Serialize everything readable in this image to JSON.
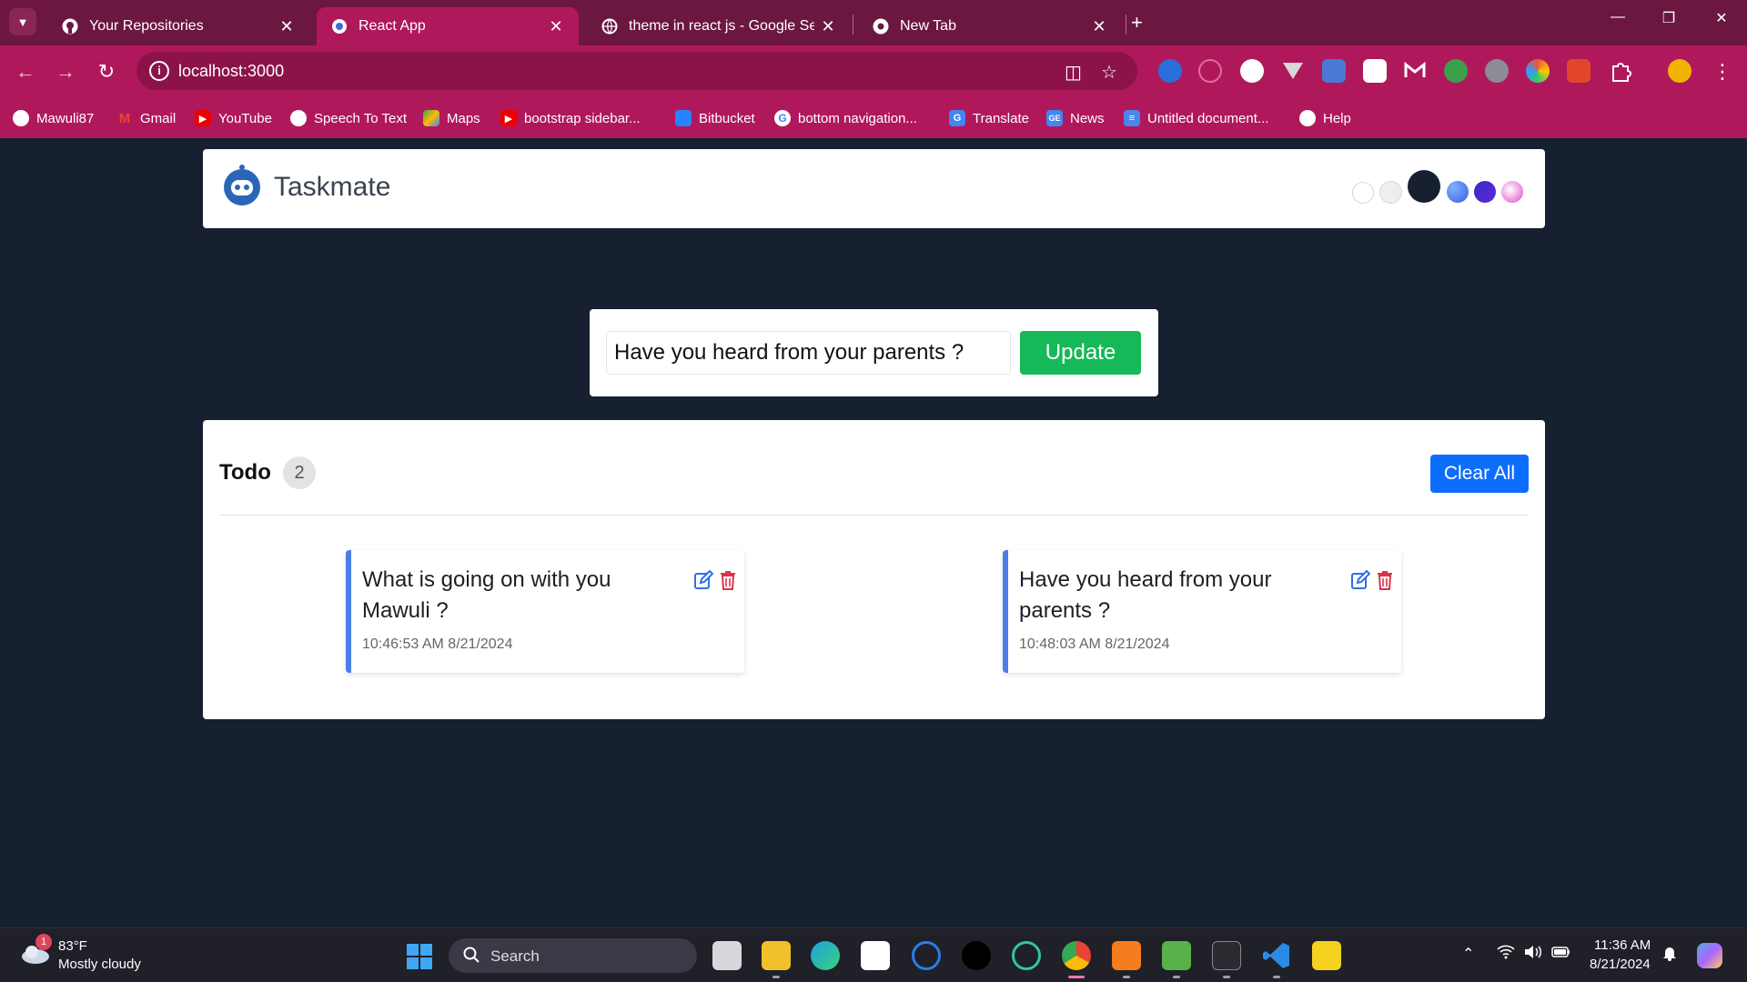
{
  "browser": {
    "tabs": [
      {
        "title": "Your Repositories",
        "icon": "github-icon"
      },
      {
        "title": "React App",
        "icon": "react-icon",
        "active": true
      },
      {
        "title": "theme in react js - Google Searc",
        "icon": "globe-icon"
      },
      {
        "title": "New Tab",
        "icon": "chrome-icon"
      }
    ],
    "url": "localhost:3000",
    "bookmarks": [
      {
        "label": "Mawuli87",
        "icon": "github-icon"
      },
      {
        "label": "Gmail",
        "icon": "gmail-icon"
      },
      {
        "label": "YouTube",
        "icon": "youtube-icon"
      },
      {
        "label": "Speech To Text",
        "icon": "globe-icon"
      },
      {
        "label": "Maps",
        "icon": "maps-icon"
      },
      {
        "label": "bootstrap sidebar...",
        "icon": "youtube-icon"
      },
      {
        "label": "Bitbucket",
        "icon": "bitbucket-icon"
      },
      {
        "label": "bottom navigation...",
        "icon": "google-icon"
      },
      {
        "label": "Translate",
        "icon": "translate-icon"
      },
      {
        "label": "News",
        "icon": "news-icon"
      },
      {
        "label": "Untitled document...",
        "icon": "docs-icon"
      },
      {
        "label": "Help",
        "icon": "chrome-icon"
      }
    ]
  },
  "app": {
    "brand": "Taskmate",
    "theme_colors": [
      "#ffffff",
      "#eeeeee",
      "#172030",
      "#3f5bdc",
      "#5a2bd6",
      "#e044c8"
    ],
    "edit_input_value": "Have you heard from your parents ?",
    "update_label": "Update",
    "todo_title": "Todo",
    "todo_count": "2",
    "clear_label": "Clear All",
    "tasks": [
      {
        "text": "What is going on with you Mawuli ?",
        "time": "10:46:53 AM 8/21/2024"
      },
      {
        "text": "Have you heard from your parents ?",
        "time": "10:48:03 AM 8/21/2024"
      }
    ]
  },
  "taskbar": {
    "weather_temp": "83°F",
    "weather_desc": "Mostly cloudy",
    "weather_badge": "1",
    "search_label": "Search",
    "time": "11:36 AM",
    "date": "8/21/2024"
  },
  "colors": {
    "chrome_accent": "#b0185c",
    "page_bg": "#172030",
    "update_green": "#16b957",
    "clear_blue": "#0d6efd",
    "card_border": "#4a7ee8",
    "delete_red": "#dc3545"
  }
}
